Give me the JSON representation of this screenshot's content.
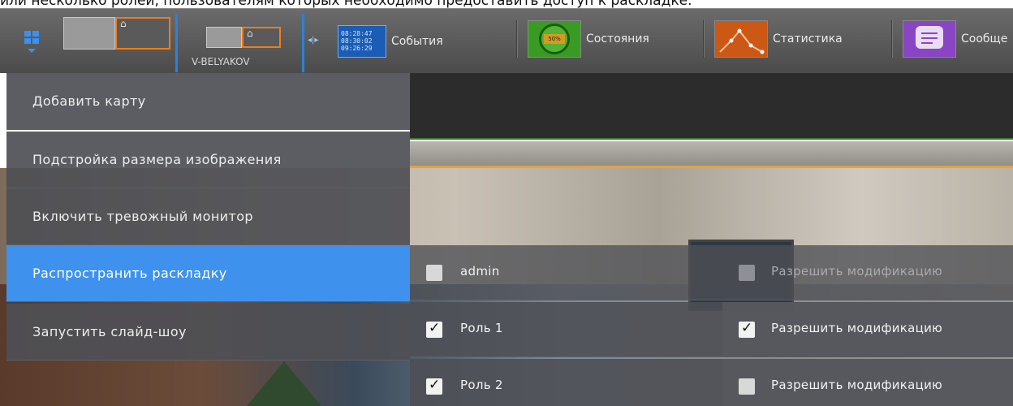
{
  "doc_text": "или несколько ролей, пользователям которых необходимо предоставить доступ к раскладке.",
  "toolbar": {
    "server_label": "V-BELYAKOV",
    "clock_lines": [
      "08:28:47",
      "08:30:02",
      "09:26:29"
    ],
    "status_pill": "50%",
    "items": [
      {
        "label": "События",
        "icon": "events-clock-icon"
      },
      {
        "label": "Состояния",
        "icon": "status-gauge-icon"
      },
      {
        "label": "Статистика",
        "icon": "statistics-chart-icon"
      },
      {
        "label": "Сообще",
        "icon": "messages-icon"
      }
    ],
    "accent_color": "#3d8ff0"
  },
  "menu": {
    "items": [
      {
        "label": "Добавить карту",
        "active": false
      },
      {
        "label": "Подстройка размера изображения",
        "active": false
      },
      {
        "label": "Включить тревожный монитор",
        "active": false
      },
      {
        "label": "Распространить раскладку",
        "active": true
      },
      {
        "label": "Запустить слайд-шоу",
        "active": false
      }
    ],
    "active_color": "#3e92ee"
  },
  "roles": {
    "rows": [
      {
        "name": "admin",
        "checked": false,
        "perm_label": "Разрешить модификацию",
        "perm_checked": false,
        "perm_enabled": false
      },
      {
        "name": "Роль 1",
        "checked": true,
        "perm_label": "Разрешить модификацию",
        "perm_checked": true,
        "perm_enabled": true
      },
      {
        "name": "Роль 2",
        "checked": true,
        "perm_label": "Разрешить модификацию",
        "perm_checked": false,
        "perm_enabled": true
      }
    ]
  }
}
